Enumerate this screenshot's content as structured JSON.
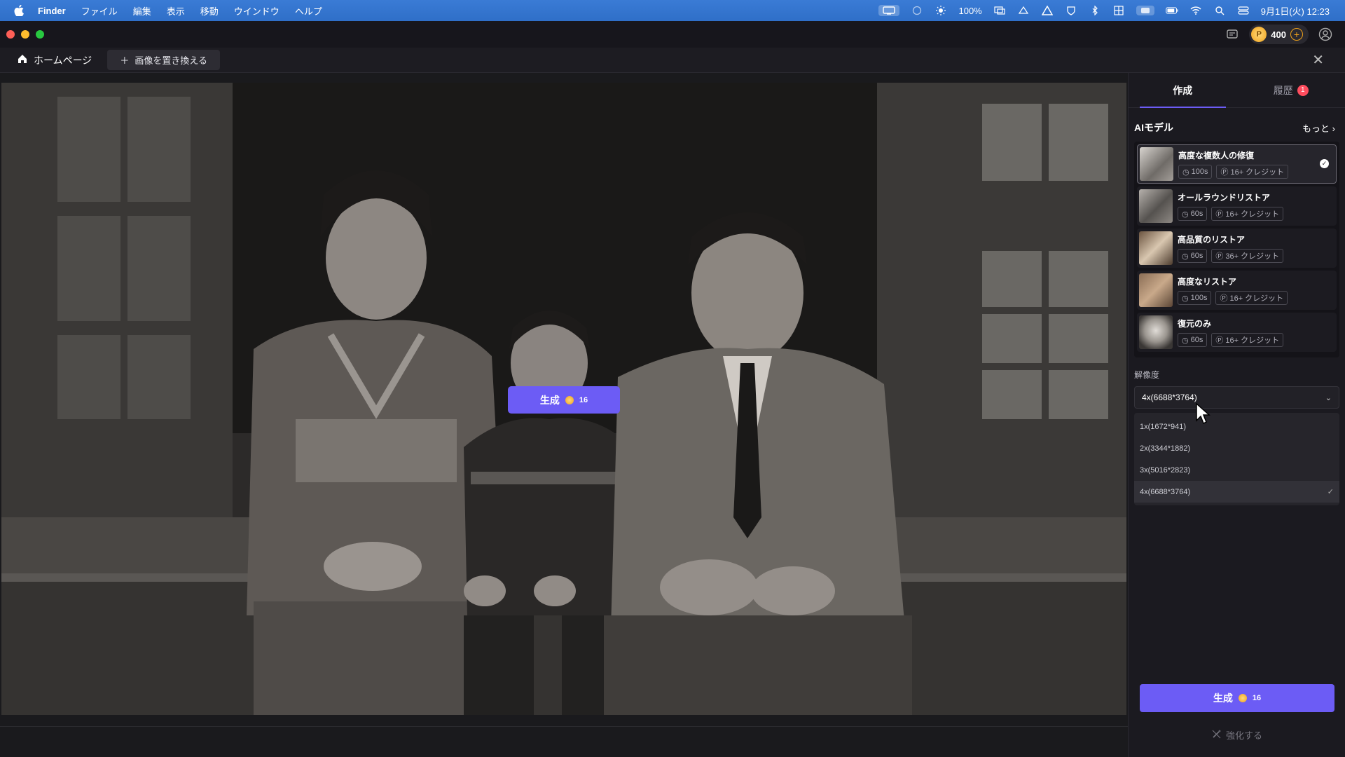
{
  "menubar": {
    "app_name": "Finder",
    "items": [
      "ファイル",
      "編集",
      "表示",
      "移動",
      "ウインドウ",
      "ヘルプ"
    ],
    "brightness": "100%",
    "datetime": "9月1日(火)  12:23"
  },
  "titlebar": {
    "credits": "400"
  },
  "toolbar": {
    "home_label": "ホームページ",
    "replace_label": "画像を置き換える"
  },
  "canvas": {
    "generate_label": "生成",
    "generate_cost": "16"
  },
  "panel": {
    "tabs": [
      {
        "label": "作成",
        "active": true
      },
      {
        "label": "履歴",
        "badge": "1"
      }
    ],
    "ai_model_title": "AIモデル",
    "more_label": "もっと",
    "models": [
      {
        "name": "高度な複数人の修復",
        "time": "100s",
        "credits": "16+ クレジット",
        "selected": true
      },
      {
        "name": "オールラウンドリストア",
        "time": "60s",
        "credits": "16+ クレジット"
      },
      {
        "name": "高品質のリストア",
        "time": "60s",
        "credits": "36+ クレジット"
      },
      {
        "name": "高度なリストア",
        "time": "100s",
        "credits": "16+ クレジット"
      },
      {
        "name": "復元のみ",
        "time": "60s",
        "credits": "16+ クレジット"
      }
    ],
    "resolution_label": "解像度",
    "resolution_value": "4x(6688*3764)",
    "resolution_options": [
      "1x(1672*941)",
      "2x(3344*1882)",
      "3x(5016*2823)",
      "4x(6688*3764)"
    ],
    "generate_label": "生成",
    "generate_cost": "16",
    "enhance_label": "強化する"
  },
  "colors": {
    "accent": "#6c5cf5",
    "menubar": "#3a7bd5",
    "badge": "#ff4d5e"
  }
}
